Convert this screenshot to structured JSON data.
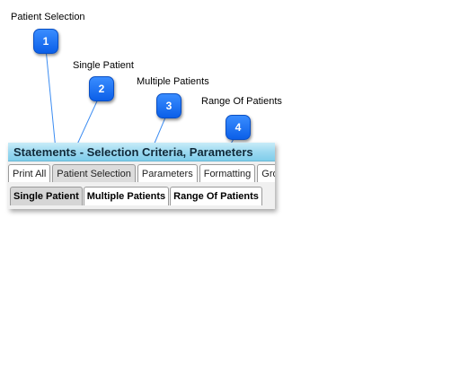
{
  "callouts": [
    {
      "number": "1",
      "label": "Patient Selection"
    },
    {
      "number": "2",
      "label": "Single Patient"
    },
    {
      "number": "3",
      "label": "Multiple Patients"
    },
    {
      "number": "4",
      "label": "Range Of Patients"
    }
  ],
  "window": {
    "title": "Statements - Selection Criteria, Parameters"
  },
  "top_tabs": [
    {
      "label": "Print All"
    },
    {
      "label": "Patient Selection"
    },
    {
      "label": "Parameters"
    },
    {
      "label": "Formatting"
    },
    {
      "label": "Gro"
    }
  ],
  "sub_tabs": [
    {
      "label": "Single Patient"
    },
    {
      "label": "Multiple Patients"
    },
    {
      "label": "Range Of Patients"
    }
  ],
  "colors": {
    "badge": "#1a6ff0",
    "leader_line": "#3b8cf2",
    "titlebar": "#9ad8f0"
  }
}
